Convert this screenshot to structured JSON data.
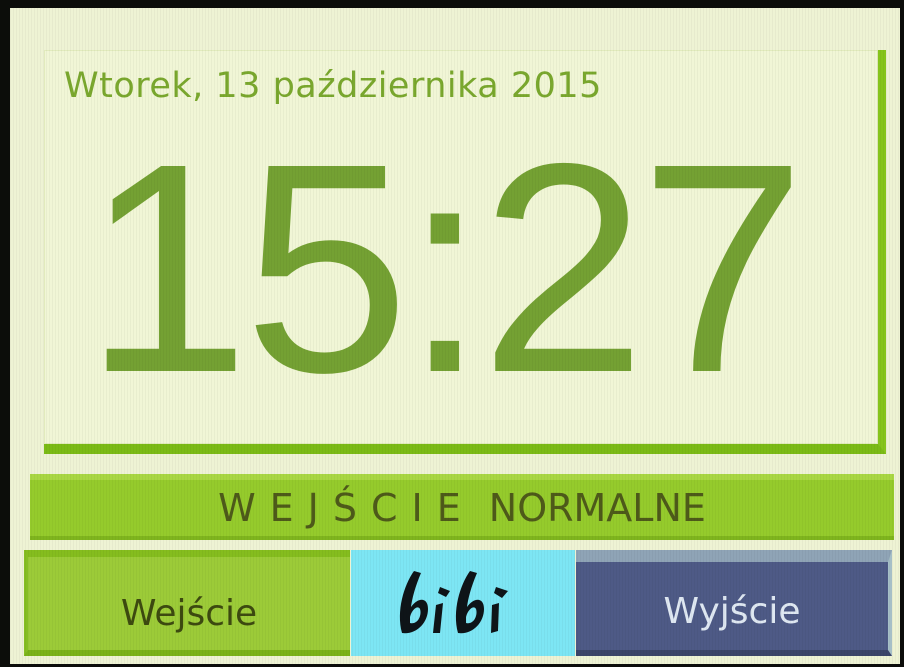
{
  "clock": {
    "date": "Wtorek, 13 października 2015",
    "time": "15:27"
  },
  "status": {
    "word1": "WEJŚCIE",
    "word2": "NORMALNE"
  },
  "buttons": {
    "enter_label": "Wejście",
    "exit_label": "Wyjście"
  },
  "logo": {
    "text": "bibi",
    "icon": "brand-logo"
  },
  "colors": {
    "screen_bg": "#eef3d4",
    "clock_text": "#74a133",
    "status_bar": "#95cb2c",
    "enter_button": "#9ccb38",
    "logo_bg": "#7de6f4",
    "exit_button": "#4e5a86"
  }
}
